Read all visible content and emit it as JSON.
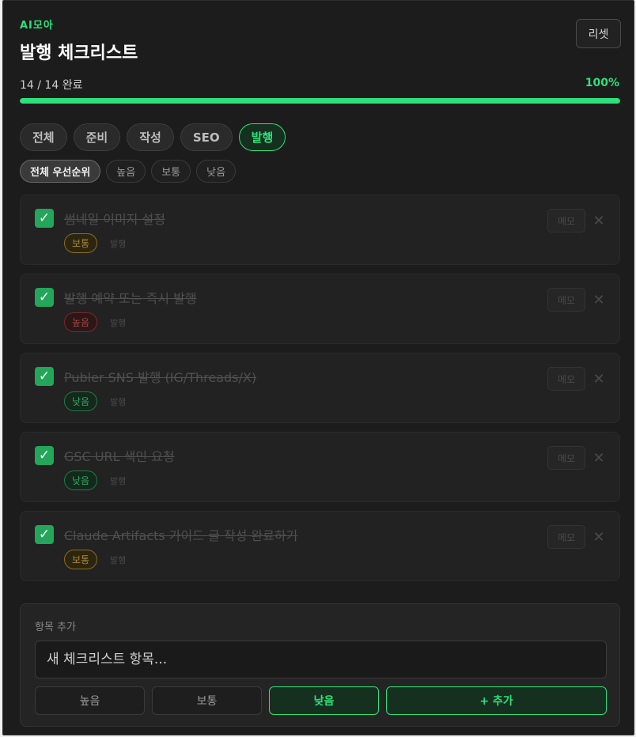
{
  "header": {
    "brand": "AI모아",
    "title": "발행 체크리스트",
    "reset_label": "리셋"
  },
  "progress": {
    "text": "14 / 14 완료",
    "percent_label": "100%",
    "fraction": 1.0
  },
  "colors": {
    "accent": "#2ee07a",
    "background": "#1c1c1c",
    "check": "#23a55a"
  },
  "tabs": [
    {
      "label": "전체",
      "active": false
    },
    {
      "label": "준비",
      "active": false
    },
    {
      "label": "작성",
      "active": false
    },
    {
      "label": "SEO",
      "active": false
    },
    {
      "label": "발행",
      "active": true
    }
  ],
  "priority_filters": [
    {
      "label": "전체 우선순위",
      "active": true
    },
    {
      "label": "높음",
      "active": false
    },
    {
      "label": "보통",
      "active": false
    },
    {
      "label": "낮음",
      "active": false
    }
  ],
  "items": [
    {
      "title": "썸네일 이미지 설정",
      "priority": "보통",
      "level": "mid",
      "category": "발행",
      "memo_label": "메모",
      "checked": true
    },
    {
      "title": "발행 예약 또는 즉시 발행",
      "priority": "높음",
      "level": "high",
      "category": "발행",
      "memo_label": "메모",
      "checked": true
    },
    {
      "title": "Publer SNS 발행 (IG/Threads/X)",
      "priority": "낮음",
      "level": "low",
      "category": "발행",
      "memo_label": "메모",
      "checked": true
    },
    {
      "title": "GSC URL 색인 요청",
      "priority": "낮음",
      "level": "low",
      "category": "발행",
      "memo_label": "메모",
      "checked": true
    },
    {
      "title": "Claude Artifacts 가이드 글 작성 완료하기",
      "priority": "보통",
      "level": "mid",
      "category": "발행",
      "memo_label": "메모",
      "checked": true
    }
  ],
  "add_panel": {
    "label": "항목 추가",
    "placeholder": "새 체크리스트 항목...",
    "priorities": [
      {
        "label": "높음",
        "active": false
      },
      {
        "label": "보통",
        "active": false
      },
      {
        "label": "낮음",
        "active": true
      }
    ],
    "add_label": "+ 추가"
  },
  "icons": {
    "check": "✓",
    "delete": "✕"
  }
}
